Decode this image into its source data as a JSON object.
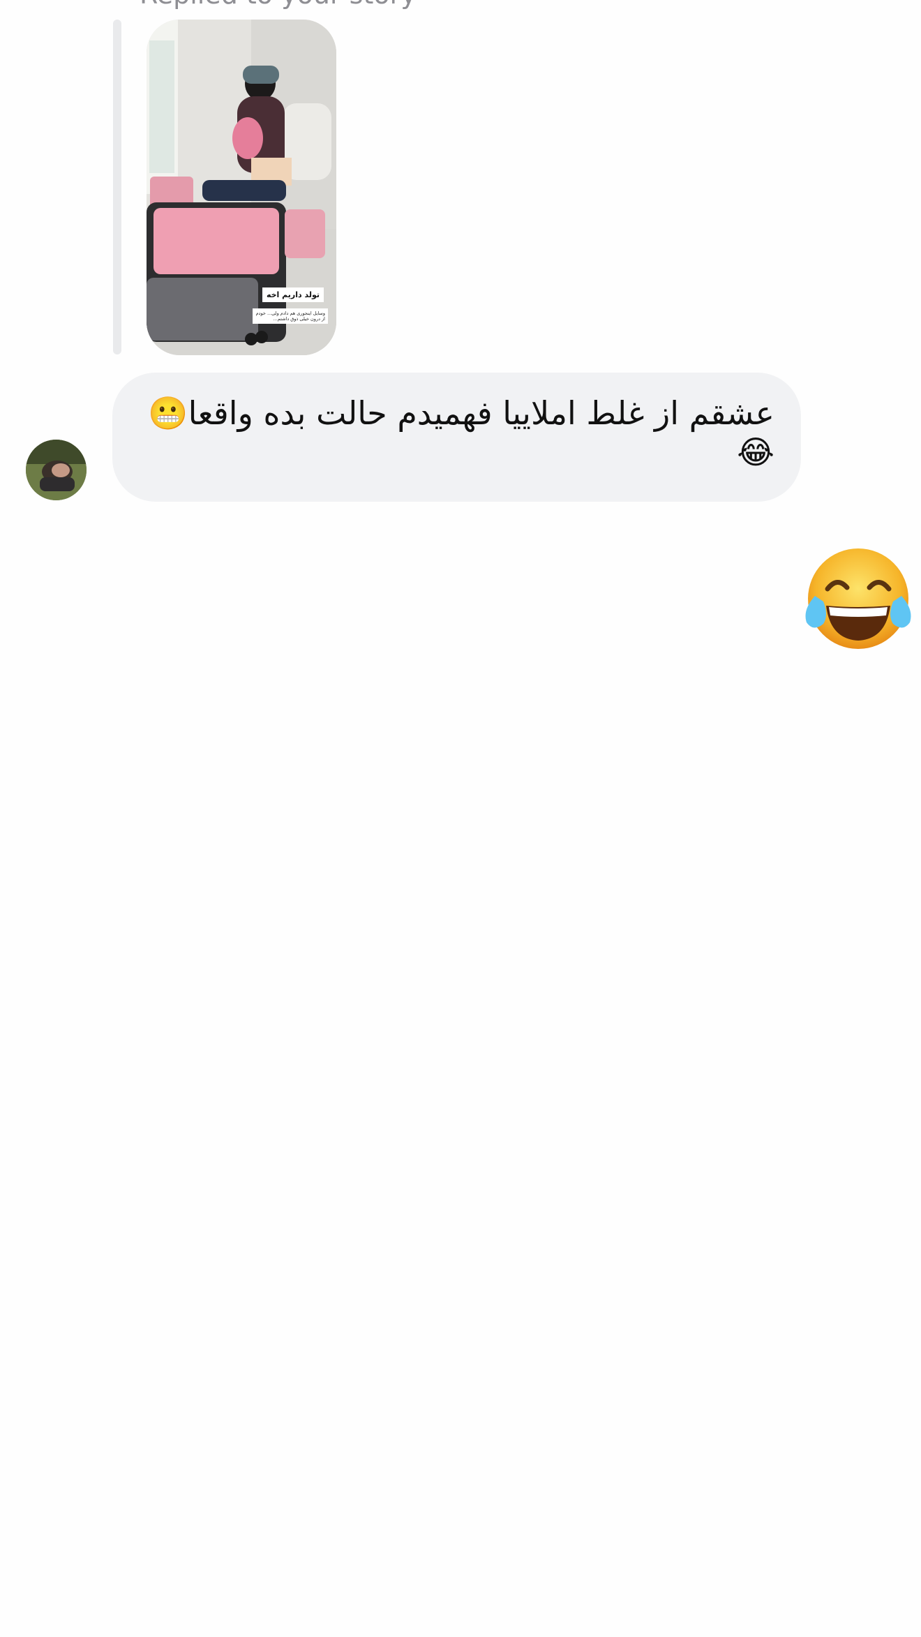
{
  "thread": {
    "replied_label": "Replied to your story",
    "story": {
      "caption_title": "تولد داریم اخه",
      "caption_body": "وسایل اینجوری هم دادم ولی... خودم از درون خیلی ذوق داشتم..."
    },
    "incoming_message": {
      "text": "عشقم از غلط املاییا فهمیدم حالت بده واقعا😬😂"
    },
    "outgoing_reaction": {
      "emoji": "😂",
      "icon": "face-with-tears-of-joy-icon"
    }
  },
  "colors": {
    "bubble_background": "#f1f2f4",
    "reply_bar": "#e9eaec",
    "label_grey": "#8e8e93",
    "text": "#111111"
  }
}
